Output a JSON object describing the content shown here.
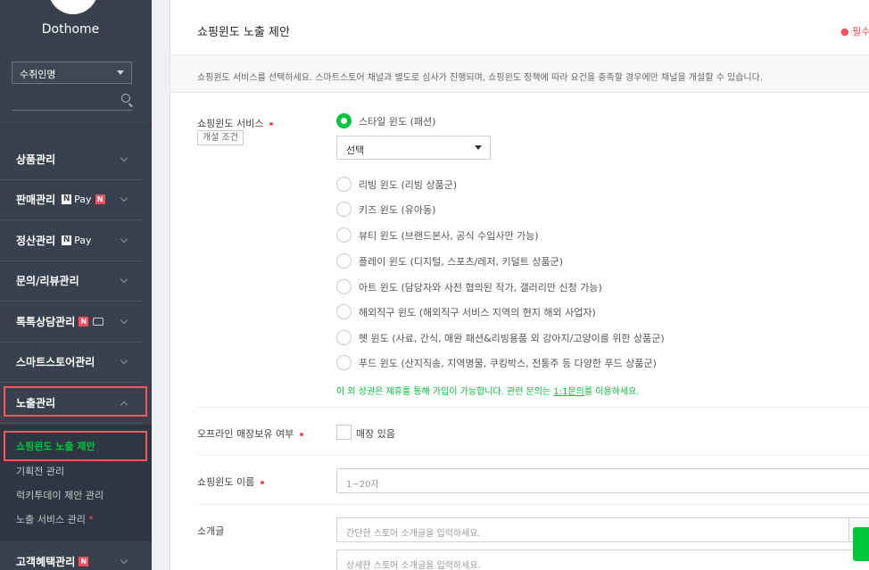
{
  "sidebar": {
    "brand": "Dothome",
    "store_select": "수취인명",
    "menu": {
      "products": "상품관리",
      "sales": "판매관리",
      "settlement": "정산관리",
      "inquiry": "문의/리뷰관리",
      "talk": "톡톡상담관리",
      "smartstore": "스마트스토어관리",
      "exposure": "노출관리",
      "customer": "고객혜택관리"
    },
    "badges": {
      "pay": "Pay",
      "n": "N"
    },
    "submenu": {
      "shopping_window": "쇼핑윈도 노출 제안",
      "special": "기획전 관리",
      "lucky_today": "럭키투데이 제안 관리",
      "exposure_service": "노출 서비스 관리",
      "required_star": "*"
    }
  },
  "header": {
    "title": "쇼핑윈도 노출 제안",
    "required_note": "● 필수항목"
  },
  "description": "쇼핑윈도 서비스를 선택하세요. 스마트스토어 채널과 별도로 심사가 진행되며, 쇼핑윈도 정책에 따라 요건을 충족할 경우에만 채널을 개설할 수 있습니다.",
  "form": {
    "service": {
      "label": "쇼핑윈도 서비스",
      "condition_button": "개설 조건",
      "selected_option": "스타일 윈도 (패션)",
      "select_value": "선택",
      "options": [
        "리빙 윈도 (리빙 상품군)",
        "키즈 윈도 (유아동)",
        "뷰티 윈도 (브랜드본사, 공식 수입사만 가능)",
        "플레이 윈도 (디지털, 스포츠/레저, 키덜트 상품군)",
        "아트 윈도 (담당자와 사전 협의된 작가, 갤러리만 신청 가능)",
        "해외직구 윈도 (해외직구 서비스 지역의 현지 해외 사업자)",
        "펫 윈도 (사료, 간식, 애완 패션&리빙용품 외 강아지/고양이를 위한 상품군)",
        "푸드 윈도 (산지직송, 지역명물, 쿠킹박스, 전통주 등 다양한 푸드 상품군)"
      ],
      "note_prefix": "이 외 상권은 제휴를 통해 가입이 가능합니다. 관련 문의는 ",
      "note_link": "1:1문의",
      "note_suffix": "를 이용하세요."
    },
    "offline": {
      "label": "오프라인 매장보유 여부",
      "checkbox_label": "매장 있음"
    },
    "name": {
      "label": "쇼핑윈도 이름",
      "placeholder": "1~20자"
    },
    "intro": {
      "label": "소개글",
      "short_placeholder": "간단한 스토어 소개글을 입력하세요.",
      "long_placeholder": "상세한 스토어 소개글을 입력하세요."
    }
  },
  "colors": {
    "accent": "#00c73c",
    "required": "#ff4b5c",
    "sidebar": "#39414e",
    "highlight": "#f05a5a"
  }
}
